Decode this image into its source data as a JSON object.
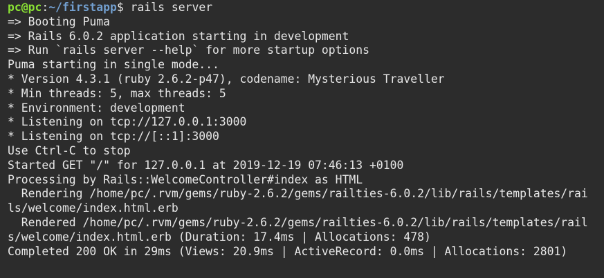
{
  "terminal": {
    "prompt": {
      "user_host": "pc@pc",
      "separator": ":",
      "path": "~/firstapp",
      "symbol": "$ ",
      "command": "rails server"
    },
    "lines": [
      "=> Booting Puma",
      "=> Rails 6.0.2 application starting in development",
      "=> Run `rails server --help` for more startup options",
      "Puma starting in single mode...",
      "* Version 4.3.1 (ruby 2.6.2-p47), codename: Mysterious Traveller",
      "* Min threads: 5, max threads: 5",
      "* Environment: development",
      "* Listening on tcp://127.0.0.1:3000",
      "* Listening on tcp://[::1]:3000",
      "Use Ctrl-C to stop",
      "Started GET \"/\" for 127.0.0.1 at 2019-12-19 07:46:13 +0100",
      "Processing by Rails::WelcomeController#index as HTML",
      "  Rendering /home/pc/.rvm/gems/ruby-2.6.2/gems/railties-6.0.2/lib/rails/templates/rai",
      "ls/welcome/index.html.erb",
      "  Rendered /home/pc/.rvm/gems/ruby-2.6.2/gems/railties-6.0.2/lib/rails/templates/rail",
      "s/welcome/index.html.erb (Duration: 17.4ms | Allocations: 478)",
      "Completed 200 OK in 29ms (Views: 20.9ms | ActiveRecord: 0.0ms | Allocations: 2801)"
    ],
    "colors": {
      "background": "#2c2c2c",
      "foreground": "#e7e7e7",
      "prompt_user": "#8ae234",
      "prompt_path": "#729fcf"
    }
  }
}
